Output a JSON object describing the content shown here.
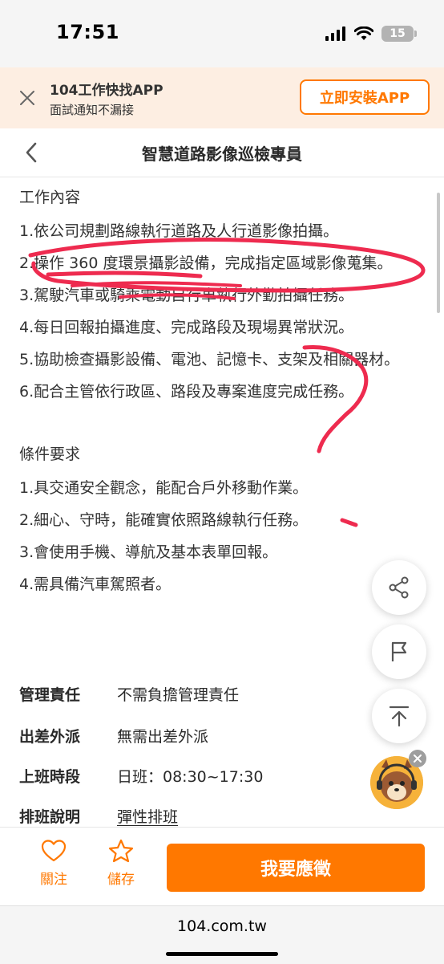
{
  "status_bar": {
    "time": "17:51",
    "battery_level": "15"
  },
  "app_banner": {
    "title": "104工作快找APP",
    "subtitle": "面試通知不漏接",
    "install_label": "立即安裝APP"
  },
  "header": {
    "title": "智慧道路影像巡檢專員"
  },
  "job_content": {
    "heading": "工作內容",
    "items": [
      "1.依公司規劃路線執行道路及人行道影像拍攝。",
      "2.操作 360 度環景攝影設備，完成指定區域影像蒐集。",
      "3.駕駛汽車或騎乘電動自行車執行外勤拍攝任務。",
      "4.每日回報拍攝進度、完成路段及現場異常狀況。",
      "5.協助檢查攝影設備、電池、記憶卡、支架及相關器材。",
      "6.配合主管依行政區、路段及專案進度完成任務。"
    ]
  },
  "requirements": {
    "heading": "條件要求",
    "items": [
      "1.具交通安全觀念，能配合戶外移動作業。",
      "2.細心、守時，能確實依照路線執行任務。",
      "3.會使用手機、導航及基本表單回報。",
      "4.需具備汽車駕照者。"
    ]
  },
  "details": [
    {
      "label": "管理責任",
      "value": "不需負擔管理責任"
    },
    {
      "label": "出差外派",
      "value": "無需出差外派"
    },
    {
      "label": "上班時段",
      "value": "日班：08:30~17:30"
    },
    {
      "label": "排班說明",
      "value": "彈性排班"
    }
  ],
  "bottom_bar": {
    "follow_label": "關注",
    "save_label": "儲存",
    "apply_label": "我要應徵"
  },
  "url_bar": {
    "url": "104.com.tw"
  },
  "icons": {
    "share": "share-icon",
    "flag": "flag-icon",
    "scroll_top": "arrow-up-icon",
    "heart": "heart-icon",
    "star": "star-icon",
    "close": "close-icon",
    "back": "chevron-left-icon"
  },
  "colors": {
    "accent": "#ff7800",
    "banner_bg": "#fdeee2",
    "annotation": "#ee2b4f"
  }
}
